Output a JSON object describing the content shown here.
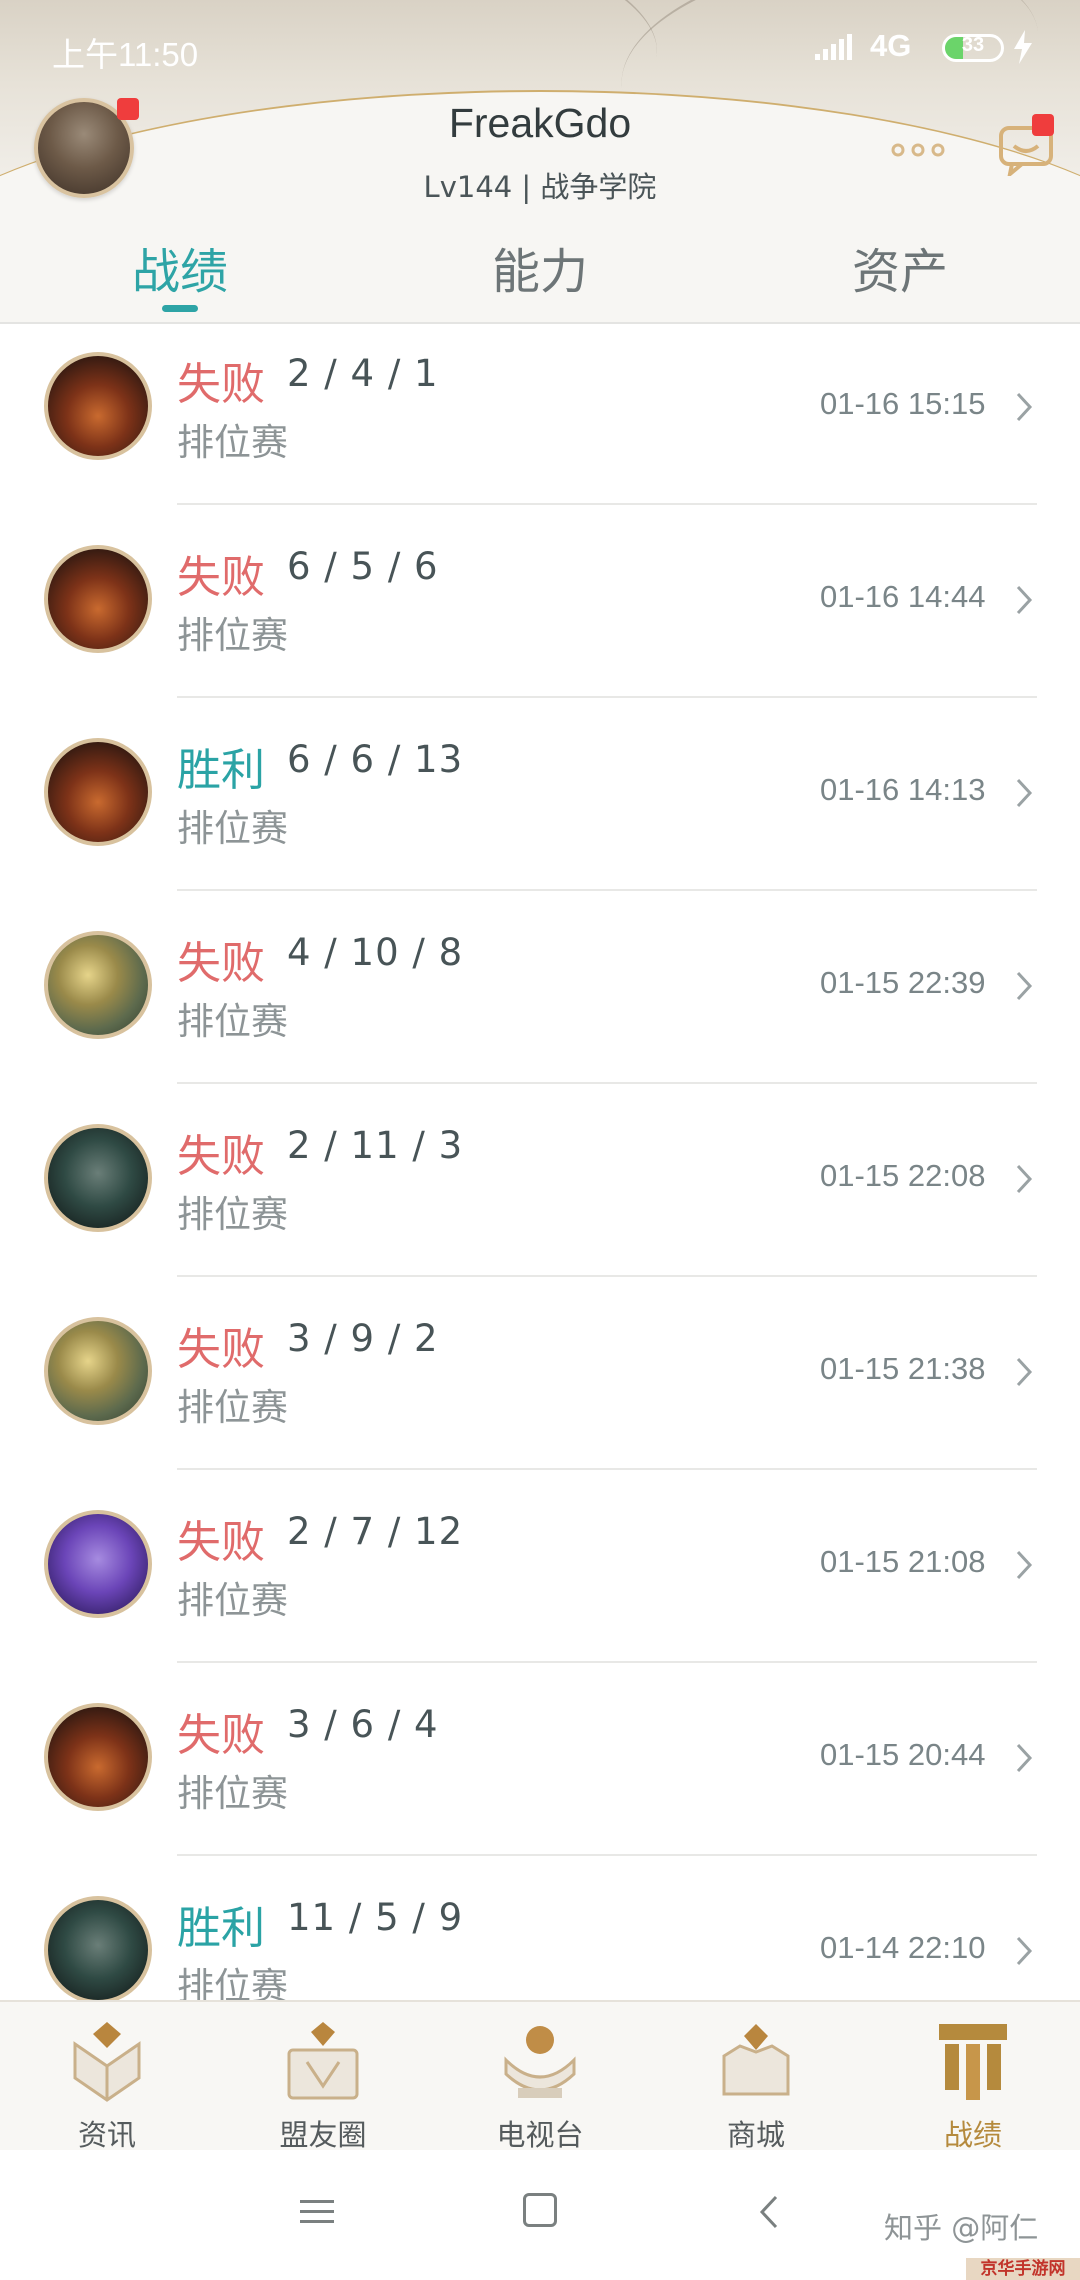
{
  "status_bar": {
    "time": "上午11:50",
    "network": "4G",
    "battery_level": "33",
    "battery_fraction": 0.33
  },
  "profile": {
    "name": "FreakGdo",
    "level": "Lv144 | 战争学院"
  },
  "tabs": [
    {
      "label": "战绩",
      "active": true
    },
    {
      "label": "能力",
      "active": false
    },
    {
      "label": "资产",
      "active": false
    }
  ],
  "matches": [
    {
      "result": "失败",
      "outcome": "lose",
      "kda": "2 / 4 / 1",
      "mode": "排位赛",
      "time": "01-16 15:15",
      "champion_icon": "champion-warrior-icon"
    },
    {
      "result": "失败",
      "outcome": "lose",
      "kda": "6 / 5 / 6",
      "mode": "排位赛",
      "time": "01-16 14:44",
      "champion_icon": "champion-warrior-icon"
    },
    {
      "result": "胜利",
      "outcome": "win",
      "kda": "6 / 6 / 13",
      "mode": "排位赛",
      "time": "01-16 14:13",
      "champion_icon": "champion-warrior-icon"
    },
    {
      "result": "失败",
      "outcome": "lose",
      "kda": "4 / 10 / 8",
      "mode": "排位赛",
      "time": "01-15 22:39",
      "champion_icon": "champion-gauntlet-icon"
    },
    {
      "result": "失败",
      "outcome": "lose",
      "kda": "2 / 11 / 3",
      "mode": "排位赛",
      "time": "01-15 22:08",
      "champion_icon": "champion-dark-knight-icon"
    },
    {
      "result": "失败",
      "outcome": "lose",
      "kda": "3 / 9 / 2",
      "mode": "排位赛",
      "time": "01-15 21:38",
      "champion_icon": "champion-gauntlet-icon"
    },
    {
      "result": "失败",
      "outcome": "lose",
      "kda": "2 / 7 / 12",
      "mode": "排位赛",
      "time": "01-15 21:08",
      "champion_icon": "champion-purple-mage-icon"
    },
    {
      "result": "失败",
      "outcome": "lose",
      "kda": "3 / 6 / 4",
      "mode": "排位赛",
      "time": "01-15 20:44",
      "champion_icon": "champion-warrior-icon"
    },
    {
      "result": "胜利",
      "outcome": "win",
      "kda": "11 / 5 / 9",
      "mode": "排位赛",
      "time": "01-14 22:10",
      "champion_icon": "champion-dark-knight-icon"
    }
  ],
  "bottom_nav": [
    {
      "label": "资讯",
      "icon": "news-icon",
      "active": false
    },
    {
      "label": "盟友圈",
      "icon": "friends-icon",
      "active": false
    },
    {
      "label": "电视台",
      "icon": "tv-icon",
      "active": false
    },
    {
      "label": "商城",
      "icon": "shop-icon",
      "active": false
    },
    {
      "label": "战绩",
      "icon": "record-icon",
      "active": true
    }
  ],
  "watermark": {
    "source": "知乎 @阿仁",
    "site": "京华手游网"
  },
  "colors": {
    "accent": "#2ea4a6",
    "lose": "#e06b6b",
    "win": "#2aa3a5",
    "gold": "#b58a3d"
  }
}
